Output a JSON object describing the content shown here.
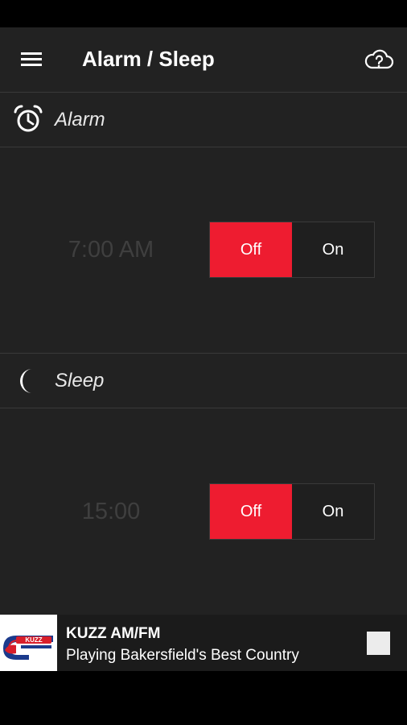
{
  "toolbar": {
    "title": "Alarm / Sleep",
    "menu_icon": "hamburger-menu-icon",
    "cloud_icon": "cloud-question-icon"
  },
  "alarm": {
    "icon": "alarm-clock-icon",
    "label": "Alarm",
    "time": "7:00 AM",
    "off_label": "Off",
    "on_label": "On",
    "state": "Off"
  },
  "sleep": {
    "icon": "crescent-moon-icon",
    "label": "Sleep",
    "time": "15:00",
    "off_label": "Off",
    "on_label": "On",
    "state": "Off"
  },
  "now_playing": {
    "station_name": "KUZZ AM/FM",
    "description": "Playing Bakersfield's Best Country",
    "logo_text": "KUZZ",
    "stop_icon": "stop-icon"
  },
  "colors": {
    "accent": "#ee1c30",
    "background": "#222222",
    "divider": "#3a3a3a",
    "time_text": "#3f3f3f"
  }
}
